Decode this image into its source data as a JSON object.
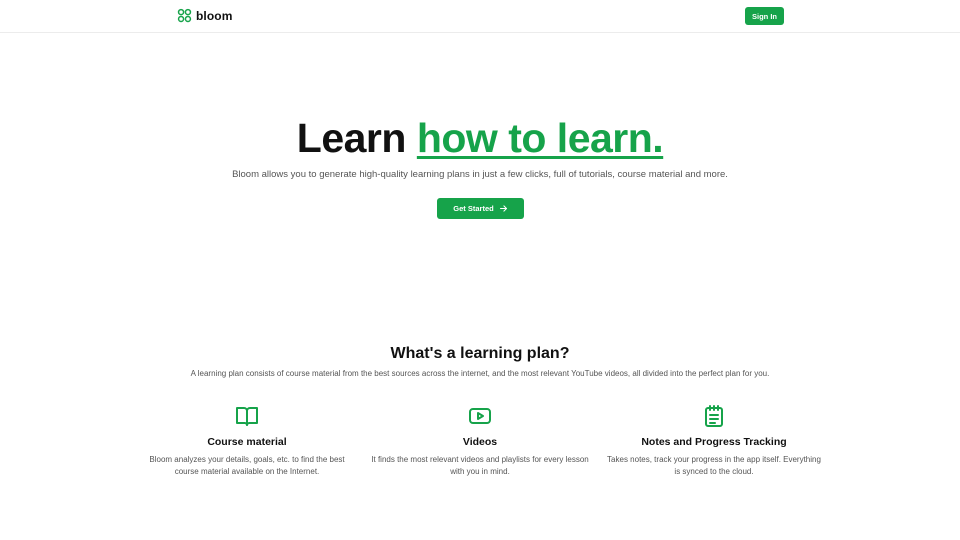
{
  "brand": {
    "name": "bloom",
    "icon": "clover-logo-icon",
    "accent": "#16a34a"
  },
  "header": {
    "signin_label": "Sign In"
  },
  "hero": {
    "title_plain": "Learn",
    "title_accent": "how to learn.",
    "subtitle": "Bloom allows you to generate high-quality learning plans in just a few clicks, full of tutorials, course material and more.",
    "cta_label": "Get Started",
    "cta_icon": "arrow-right-icon"
  },
  "plan": {
    "title": "What's a learning plan?",
    "subtitle": "A learning plan consists of course material from the best sources across the internet, and the most relevant YouTube videos, all divided into the perfect plan for you.",
    "features": [
      {
        "icon": "book-open-icon",
        "title": "Course material",
        "description": "Bloom analyzes your details, goals, etc. to find the best course material available on the Internet."
      },
      {
        "icon": "video-play-icon",
        "title": "Videos",
        "description": "It finds the most relevant videos and playlists for every lesson with you in mind."
      },
      {
        "icon": "notepad-icon",
        "title": "Notes and Progress Tracking",
        "description": "Takes notes, track your progress in the app itself. Everything is synced to the cloud."
      }
    ]
  }
}
